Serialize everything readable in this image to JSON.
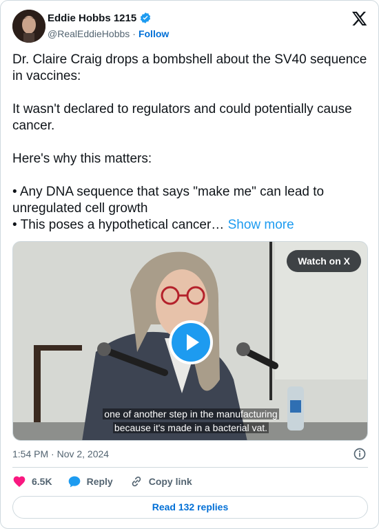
{
  "author": {
    "name": "Eddie Hobbs 1215",
    "handle": "@RealEddieHobbs",
    "separator": "·",
    "follow_label": "Follow"
  },
  "tweet": {
    "lines": [
      "Dr. Claire Craig drops a bombshell about the SV40 sequence in vaccines:",
      "It wasn't declared to regulators and could potentially cause cancer.",
      "Here's why this matters:",
      "• Any DNA sequence that says \"make me\" can lead to unregulated cell growth",
      "• This poses a hypothetical cancer…"
    ],
    "show_more_label": "Show more"
  },
  "media": {
    "watch_label": "Watch on X",
    "caption_line1": "one of another step in the manufacturing",
    "caption_line2": "because it's made in a bacterial vat."
  },
  "meta": {
    "timestamp": "1:54 PM · Nov 2, 2024"
  },
  "actions": {
    "like_count": "6.5K",
    "reply_label": "Reply",
    "copy_link_label": "Copy link",
    "read_replies_label": "Read 132 replies"
  },
  "colors": {
    "verified": "#1d9bf0",
    "like": "#f91880",
    "link": "#006fd6",
    "reply_icon": "#1d9bf0"
  },
  "icons": [
    "avatar",
    "verified-badge-icon",
    "x-logo-icon",
    "play-icon",
    "info-icon",
    "heart-icon",
    "reply-icon",
    "link-icon"
  ]
}
